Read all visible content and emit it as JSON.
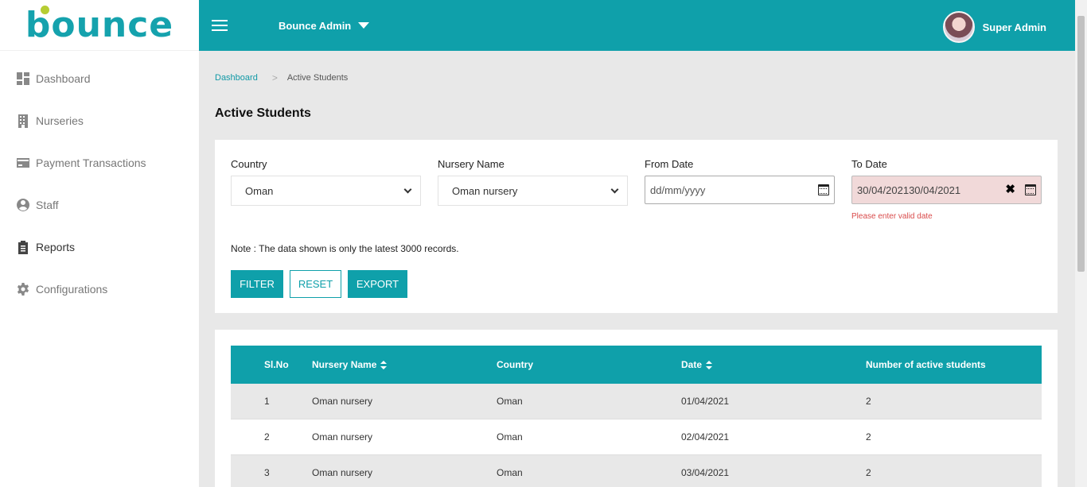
{
  "app": {
    "logo_text": "bounce",
    "brand_name": "Bounce Admin",
    "user_name": "Super Admin"
  },
  "sidebar": {
    "items": [
      {
        "label": "Dashboard",
        "icon": "dashboard-icon"
      },
      {
        "label": "Nurseries",
        "icon": "building-icon"
      },
      {
        "label": "Payment Transactions",
        "icon": "credit-card-icon"
      },
      {
        "label": "Staff",
        "icon": "user-circle-icon"
      },
      {
        "label": "Reports",
        "icon": "clipboard-icon"
      },
      {
        "label": "Configurations",
        "icon": "gear-icon"
      }
    ]
  },
  "breadcrumb": {
    "home": "Dashboard",
    "separator": ">",
    "current": "Active Students"
  },
  "page": {
    "title": "Active Students"
  },
  "filters": {
    "country": {
      "label": "Country",
      "value": "Oman"
    },
    "nursery": {
      "label": "Nursery Name",
      "value": "Oman nursery"
    },
    "from_date": {
      "label": "From Date",
      "placeholder": "dd/mm/yyyy"
    },
    "to_date": {
      "label": "To Date",
      "value": "30/04/202130/04/2021",
      "error": "Please enter valid date"
    },
    "note": "Note : The data shown is only the latest 3000 records.",
    "buttons": {
      "filter": "FILTER",
      "reset": "RESET",
      "export": "EXPORT"
    }
  },
  "table": {
    "headers": {
      "sl_no": "Sl.No",
      "nursery": "Nursery Name",
      "country": "Country",
      "date": "Date",
      "active": "Number of active students"
    },
    "rows": [
      {
        "sl_no": "1",
        "nursery": "Oman nursery",
        "country": "Oman",
        "date": "01/04/2021",
        "active": "2"
      },
      {
        "sl_no": "2",
        "nursery": "Oman nursery",
        "country": "Oman",
        "date": "02/04/2021",
        "active": "2"
      },
      {
        "sl_no": "3",
        "nursery": "Oman nursery",
        "country": "Oman",
        "date": "03/04/2021",
        "active": "2"
      }
    ]
  },
  "colors": {
    "accent": "#0fa0aa",
    "logo_dot": "#b6cd33",
    "error": "#d94b4b"
  }
}
